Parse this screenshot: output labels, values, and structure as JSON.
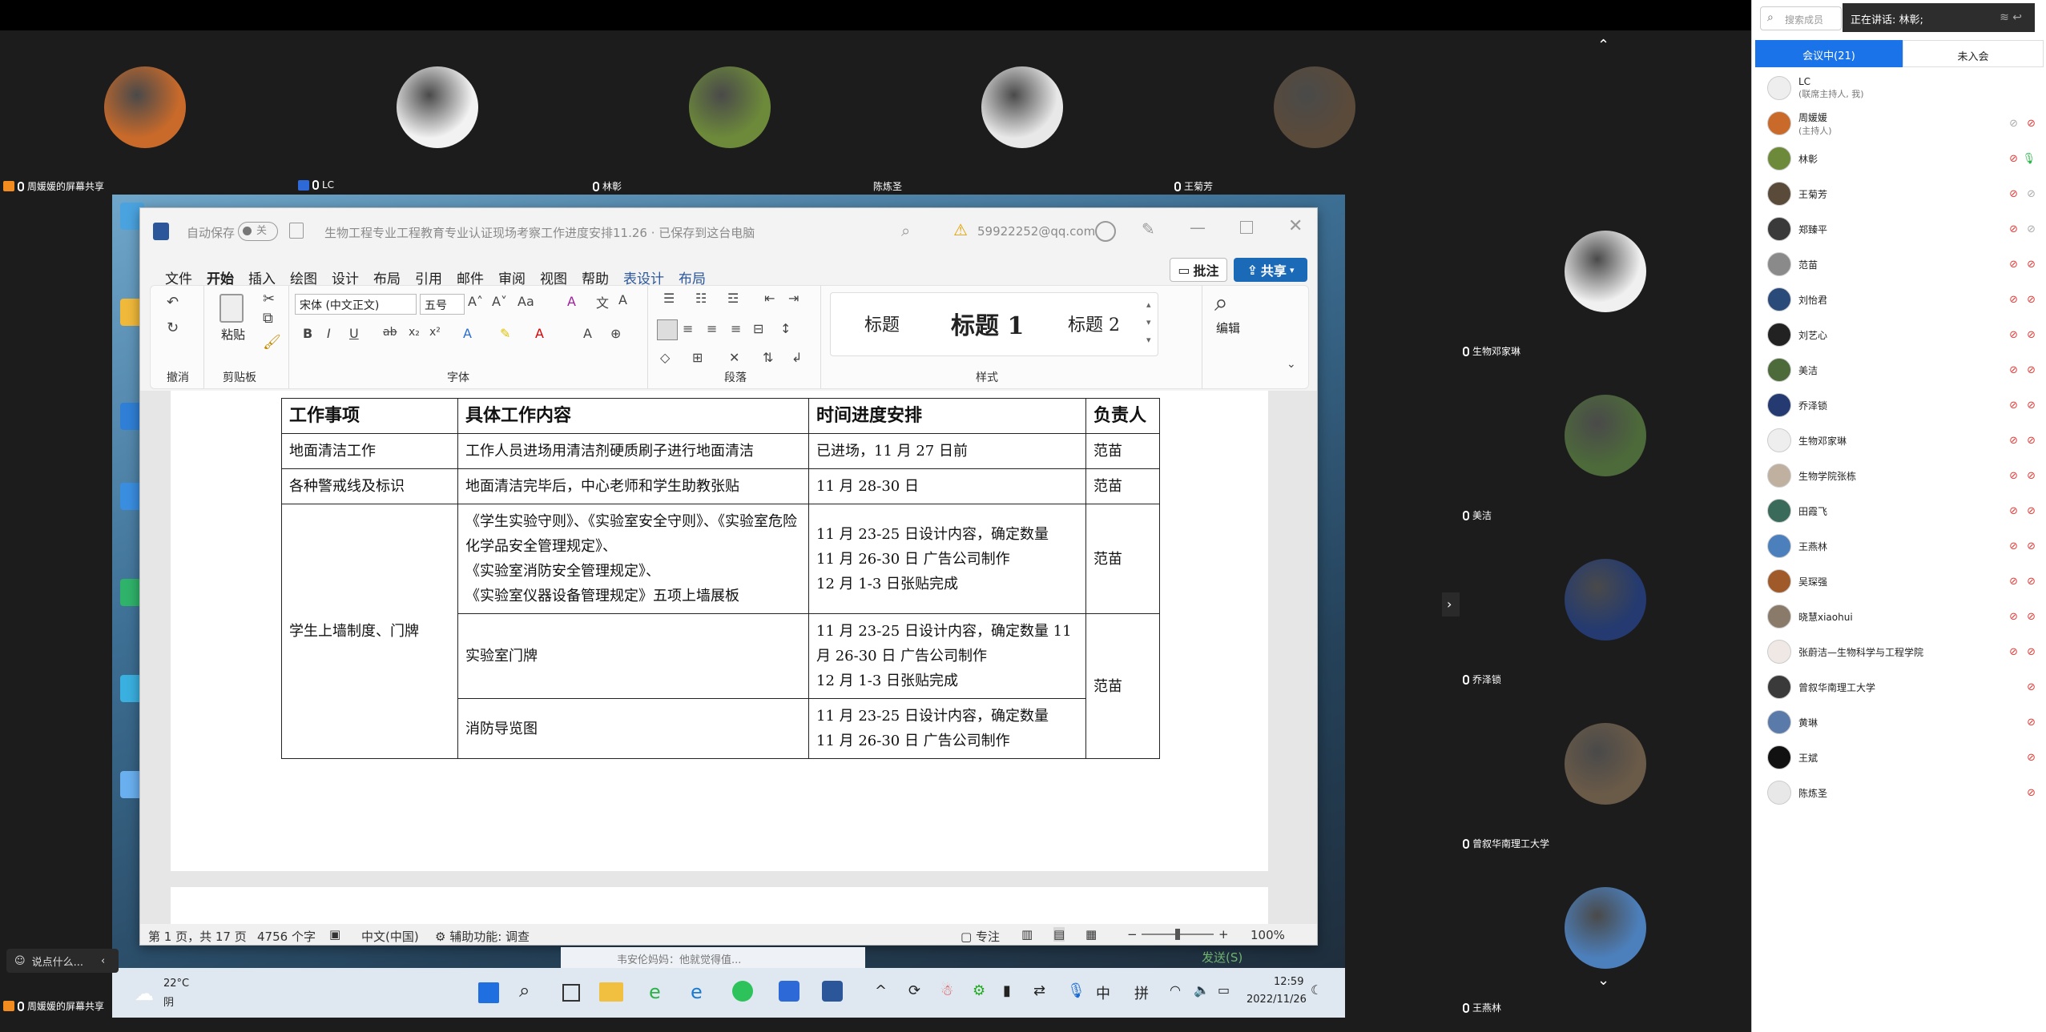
{
  "meeting": {
    "share_label_top": "周媛媛的屏幕共享",
    "share_label_bottom": "周媛媛的屏幕共享",
    "top_tiles": [
      {
        "label": "周媛媛的屏幕共享",
        "color": "#c96a2a"
      },
      {
        "label": "LC",
        "color": "#f2f2f2"
      },
      {
        "label": "林彰",
        "color": "#6d8a3a"
      },
      {
        "label": "陈炼圣",
        "color": "#e8e8e8"
      },
      {
        "label": "王菊芳",
        "color": "#5a4a3a"
      },
      {
        "label": "张蔚洁—生物科学与工程学院",
        "color": "#efe8e4"
      }
    ],
    "right_tiles": [
      {
        "label": "生物邓家琳",
        "color": "#f0f0f0"
      },
      {
        "label": "美洁",
        "color": "#4d6a3a"
      },
      {
        "label": "乔泽锁",
        "color": "#243a70"
      },
      {
        "label": "曾叙华南理工大学",
        "color": "#6a5a48"
      },
      {
        "label": "王燕林",
        "color": "#4c80bd"
      }
    ],
    "chat_placeholder": "说点什么..."
  },
  "word": {
    "autosave": "自动保存",
    "autosave_state": "关",
    "doc_title": "生物工程专业工程教育专业认证现场考察工作进度安排11.26 · 已保存到这台电脑",
    "account": "59922252@qq.com",
    "menu": [
      "文件",
      "开始",
      "插入",
      "绘图",
      "设计",
      "布局",
      "引用",
      "邮件",
      "审阅",
      "视图",
      "帮助",
      "表设计",
      "布局"
    ],
    "comment_btn": "批注",
    "share_btn": "共享",
    "ribbon": {
      "undo_label": "撤消",
      "paste": "粘贴",
      "clipboard_label": "剪贴板",
      "font_name": "宋体 (中文正文)",
      "font_size": "五号",
      "font_label": "字体",
      "paragraph_label": "段落",
      "styles": [
        "标题",
        "标题 1",
        "标题 2"
      ],
      "styles_label": "样式",
      "edit": "编辑"
    },
    "table": {
      "headers": [
        "工作事项",
        "具体工作内容",
        "时间进度安排",
        "负责人"
      ],
      "r1": [
        "地面清洁工作",
        "工作人员进场用清洁剂硬质刷子进行地面清洁",
        "已进场，11 月 27 日前",
        "范苗"
      ],
      "r2": [
        "各种警戒线及标识",
        "地面清洁完毕后，中心老师和学生助教张贴",
        "11 月 28-30 日",
        "范苗"
      ],
      "r3_item": "学生上墙制度、门牌",
      "r3_content": [
        "《学生实验守则》、《实验室安全守则》、《实验室危险化学品安全管理规定》、",
        "《实验室消防安全管理规定》、",
        "《实验室仪器设备管理规定》五项上墙展板"
      ],
      "r3_time": [
        "11 月 23-25 日设计内容，确定数量",
        "11 月 26-30 日 广告公司制作",
        "12 月 1-3 日张贴完成"
      ],
      "r3_person": "范苗",
      "r4_content": "实验室门牌",
      "r4_time": [
        "11 月 23-25 日设计内容，确定数量 11 月 26-30 日 广告公司制作",
        "12 月 1-3 日张贴完成"
      ],
      "r5_content": "消防导览图",
      "r5_time": [
        "11 月 23-25 日设计内容，确定数量",
        "11 月 26-30 日 广告公司制作"
      ],
      "r45_person": "范苗"
    },
    "status": {
      "page": "第 1 页，共 17 页",
      "words": "4756 个字",
      "lang": "中文(中国)",
      "access": "辅助功能: 调查",
      "focus": "专注",
      "zoom": "100%"
    }
  },
  "taskbar": {
    "weather_temp": "22°C",
    "weather_desc": "阴",
    "time": "12:59",
    "date": "2022/11/26",
    "ime_cn": "中",
    "ime_py": "拼",
    "notif_text": "韦安伦妈妈：他就觉得值...",
    "send_text": "发送(S)"
  },
  "panel": {
    "search_placeholder": "搜索成员",
    "speaking": "正在讲话: 林彰;",
    "tab_in": "会议中(21)",
    "tab_out": "未入会",
    "members": [
      {
        "name": "LC",
        "sub": "(联席主持人, 我)",
        "color": "#eee"
      },
      {
        "name": "周媛媛",
        "sub": "(主持人)",
        "color": "#c96a2a"
      },
      {
        "name": "林彰",
        "sub": "",
        "color": "#6d8a3a"
      },
      {
        "name": "王菊芳",
        "sub": "",
        "color": "#5a4a3a"
      },
      {
        "name": "郑臻平",
        "sub": "",
        "color": "#3a3a3a"
      },
      {
        "name": "范苗",
        "sub": "",
        "color": "#8a8a8a"
      },
      {
        "name": "刘怡君",
        "sub": "",
        "color": "#2a4a7a"
      },
      {
        "name": "刘艺心",
        "sub": "",
        "color": "#222"
      },
      {
        "name": "美洁",
        "sub": "",
        "color": "#4d6a3a"
      },
      {
        "name": "乔泽锁",
        "sub": "",
        "color": "#243a70"
      },
      {
        "name": "生物邓家琳",
        "sub": "",
        "color": "#eee"
      },
      {
        "name": "生物学院张栋",
        "sub": "",
        "color": "#c0b0a0"
      },
      {
        "name": "田霞飞",
        "sub": "",
        "color": "#3a6a5a"
      },
      {
        "name": "王燕林",
        "sub": "",
        "color": "#4c80bd"
      },
      {
        "name": "吴琛强",
        "sub": "",
        "color": "#a05a2a"
      },
      {
        "name": "晓慧xiaohui",
        "sub": "",
        "color": "#8a7a6a"
      },
      {
        "name": "张蔚洁—生物科学与工程学院",
        "sub": "",
        "color": "#efe8e4"
      },
      {
        "name": "曾叙华南理工大学",
        "sub": "",
        "color": "#3a3a3a"
      },
      {
        "name": "黄琳",
        "sub": "",
        "color": "#5a7aaa"
      },
      {
        "name": "王斌",
        "sub": "",
        "color": "#111"
      },
      {
        "name": "陈炼圣",
        "sub": "",
        "color": "#e8e8e8"
      }
    ]
  }
}
